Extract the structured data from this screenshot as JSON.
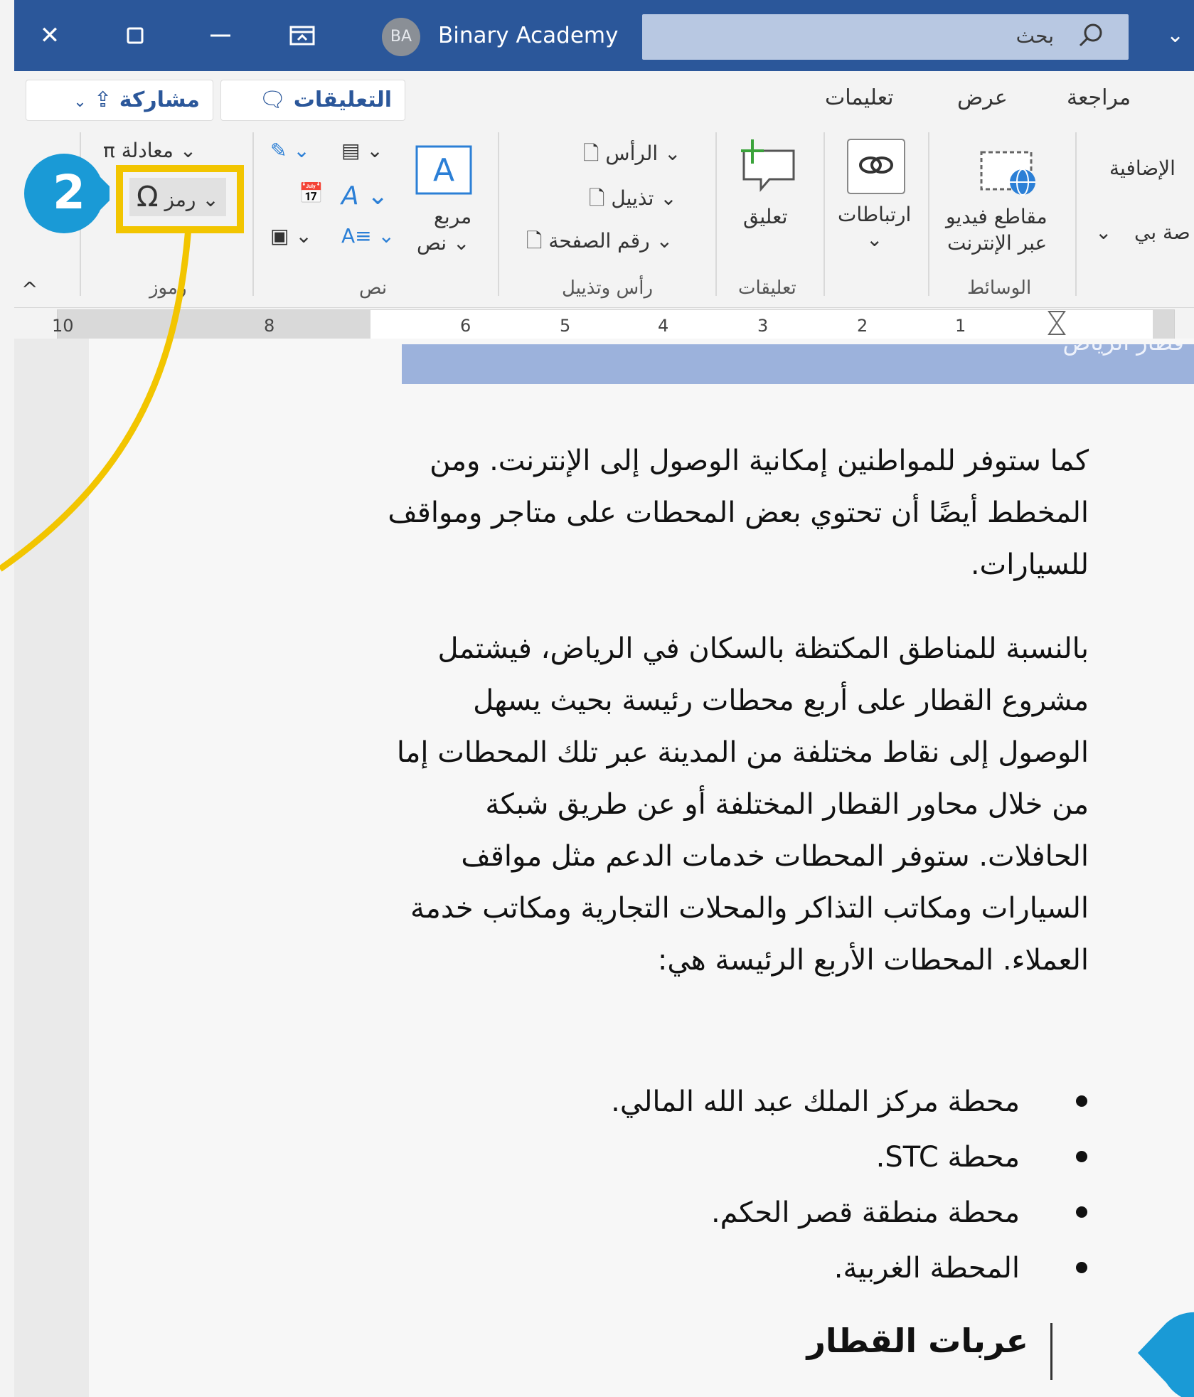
{
  "titlebar": {
    "account_initials": "BA",
    "account_name": "Binary Academy",
    "search_placeholder": "بحث"
  },
  "ribbon": {
    "tabs": [
      "مراجعة",
      "عرض",
      "تعليمات"
    ],
    "comments_button": "التعليقات",
    "share_button": "مشاركة",
    "groups": {
      "media_label": "الوسائط",
      "online_video": [
        "مقاطع فيديو",
        "عبر الإنترنت"
      ],
      "links_label": "ارتباطات",
      "comments_group_label": "تعليقات",
      "comment_button": "تعليق",
      "header_footer_label": "رأس وتذييل",
      "header": "الرأس",
      "footer": "تذييل",
      "page_number": "رقم الصفحة",
      "text_label": "نص",
      "textbox": [
        "مربع",
        "نص"
      ],
      "symbols_label": "رموز",
      "equation": "معادلة",
      "symbol": "رمز",
      "addins_partial": "الإضافية",
      "addins_partial2": "صة بي"
    }
  },
  "ruler": {
    "ticks": [
      "10",
      "8",
      "6",
      "5",
      "4",
      "3",
      "2",
      "1"
    ]
  },
  "document": {
    "heading_band": "قطار الرياض",
    "para1": "كما ستوفر للمواطنين إمكانية الوصول إلى الإنترنت. ومن المخطط أيضًا أن تحتوي بعض المحطات على متاجر ومواقف للسيارات.",
    "para2": "بالنسبة للمناطق المكتظة بالسكان في الرياض، فيشتمل مشروع القطار على أربع محطات رئيسة بحيث يسهل الوصول إلى نقاط مختلفة من المدينة عبر تلك المحطات إما من خلال محاور القطار المختلفة أو عن طريق شبكة الحافلات. ستوفر المحطات خدمات الدعم مثل مواقف السيارات ومكاتب التذاكر والمحلات التجارية ومكاتب خدمة العملاء. المحطات الأربع الرئيسة هي:",
    "bullets": [
      "محطة مركز الملك عبد الله المالي.",
      "محطة STC.",
      "محطة منطقة قصر الحكم.",
      "المحطة الغربية."
    ],
    "subheading": "عربات القطار"
  },
  "callout": {
    "number": "2",
    "color": "#f2c500",
    "badge_color": "#1a9ad6"
  }
}
